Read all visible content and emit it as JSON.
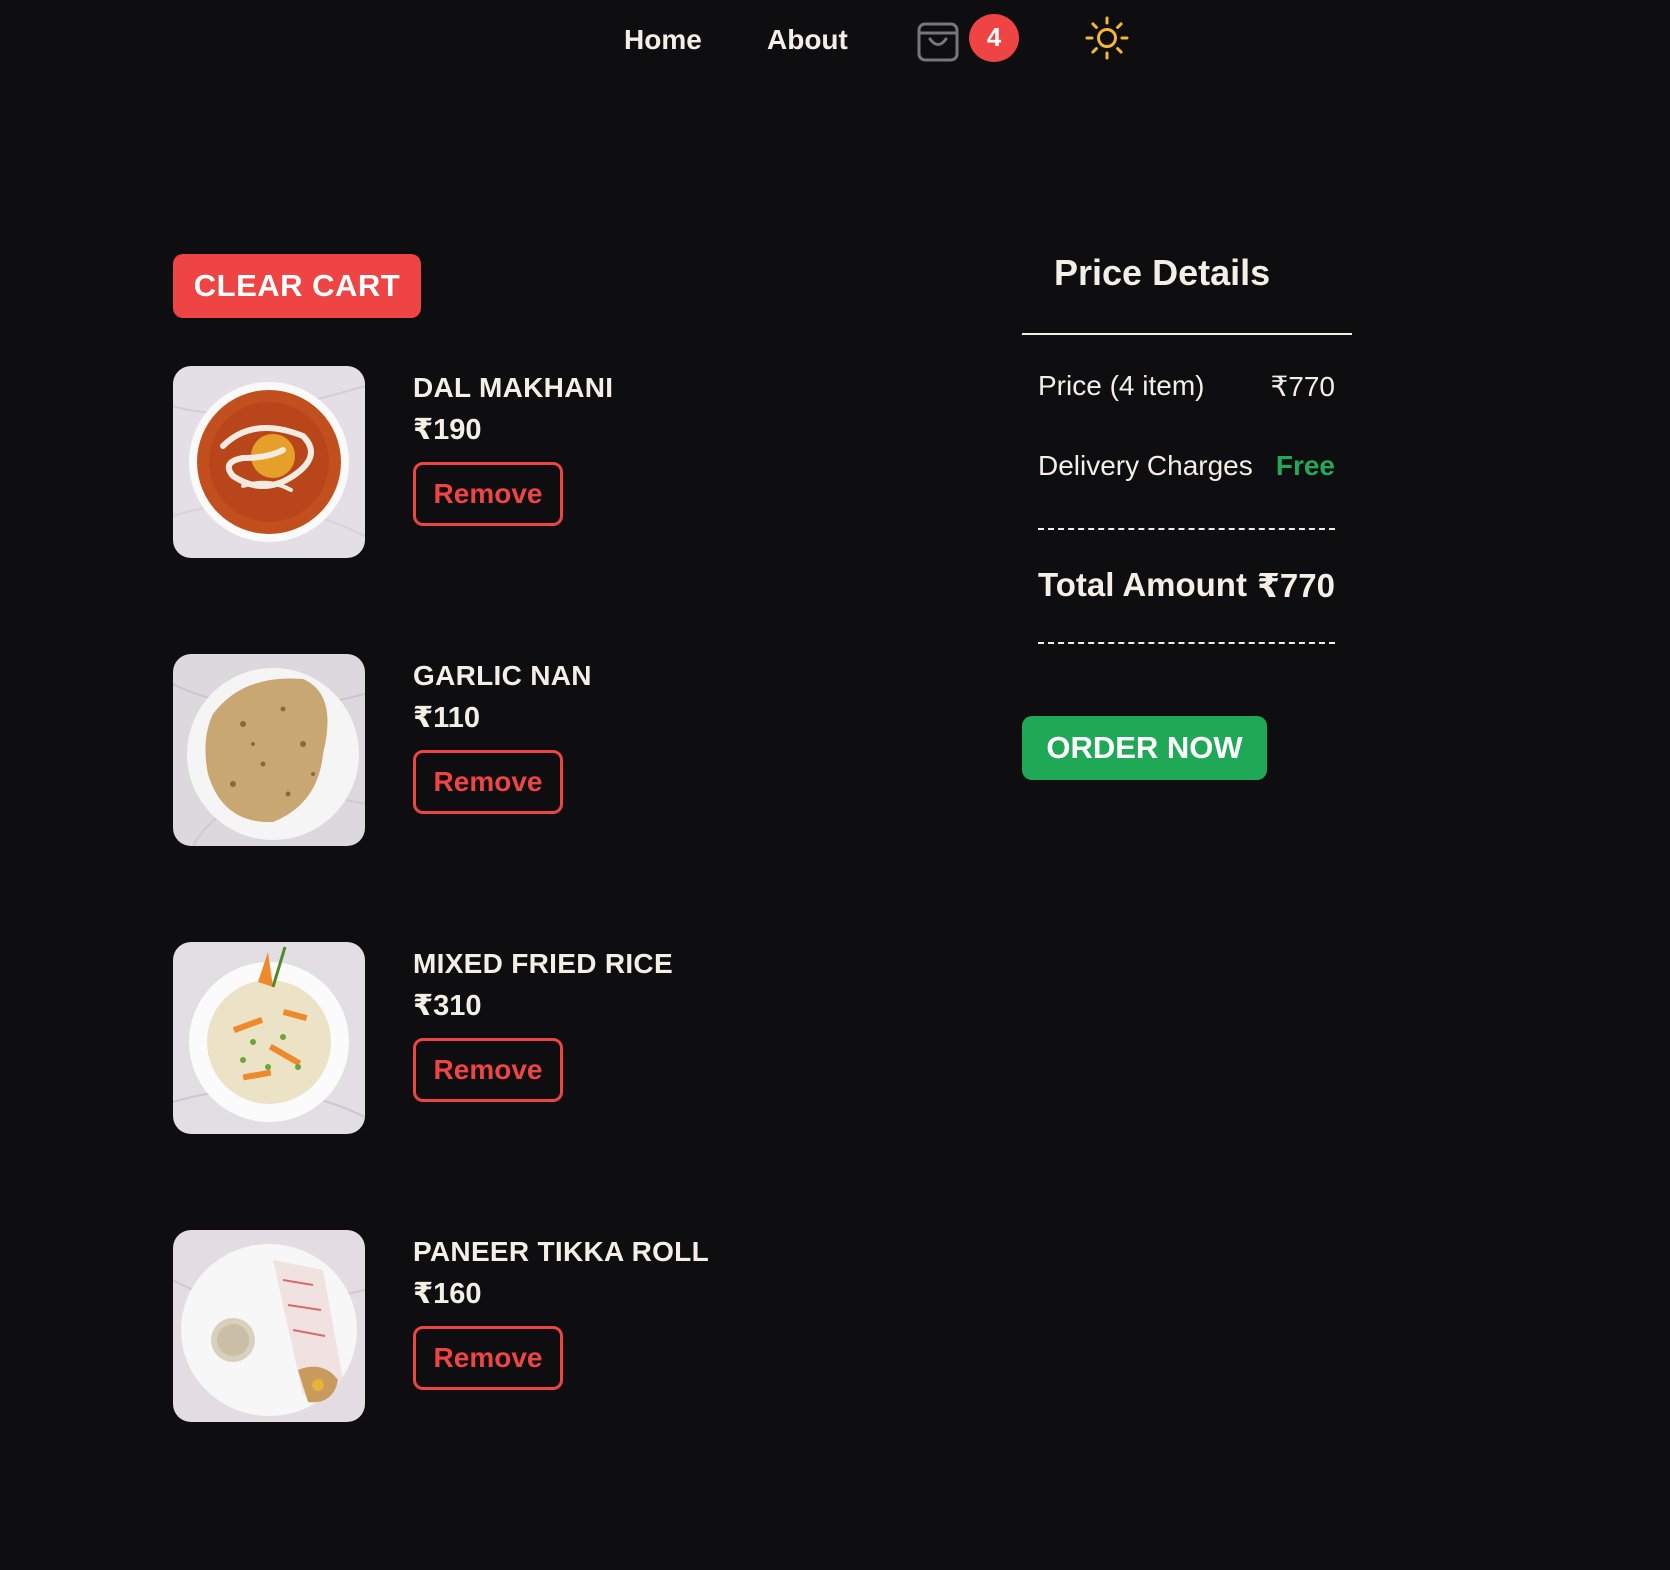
{
  "nav": {
    "home_label": "Home",
    "about_label": "About",
    "cart_count": "4",
    "cart_icon": "shopping-bag-icon",
    "theme_icon": "sun-icon"
  },
  "cart": {
    "clear_label": "CLEAR CART",
    "items": [
      {
        "name": "DAL MAKHANI",
        "price": "₹190",
        "remove_label": "Remove",
        "image": "dal-makhani-photo"
      },
      {
        "name": "GARLIC NAN",
        "price": "₹110",
        "remove_label": "Remove",
        "image": "garlic-nan-photo"
      },
      {
        "name": "MIXED FRIED RICE",
        "price": "₹310",
        "remove_label": "Remove",
        "image": "mixed-fried-rice-photo"
      },
      {
        "name": "PANEER TIKKA ROLL",
        "price": "₹160",
        "remove_label": "Remove",
        "image": "paneer-tikka-roll-photo"
      }
    ]
  },
  "price_details": {
    "title": "Price Details",
    "price_label": "Price (4 item)",
    "price_value": "₹770",
    "delivery_label": "Delivery Charges",
    "delivery_value": "Free",
    "total_label": "Total Amount",
    "total_value": "₹770",
    "order_label": "ORDER NOW"
  },
  "colors": {
    "background": "#0e0d0f",
    "accent_red": "#ef4444",
    "accent_green": "#1fa855",
    "sun_yellow": "#f5b82e"
  }
}
